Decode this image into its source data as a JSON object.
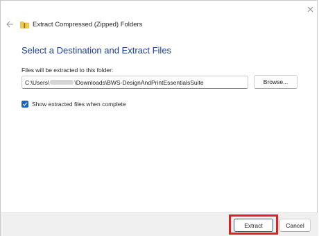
{
  "window": {
    "title": "Extract Compressed (Zipped) Folders",
    "title_icon": "zip-folder-icon",
    "close_icon": "close-icon",
    "back_icon": "back-arrow-icon"
  },
  "main": {
    "heading": "Select a Destination and Extract Files",
    "path_label": "Files will be extracted to this folder:",
    "path_prefix": "C:\\Users\\",
    "path_suffix": "\\Downloads\\BWS-DesignAndPrintEssentialsSuite",
    "browse_label": "Browse...",
    "show_files_label": "Show extracted files when complete",
    "show_files_checked": true
  },
  "footer": {
    "extract_label": "Extract",
    "cancel_label": "Cancel"
  },
  "colors": {
    "heading": "#1a3f91",
    "accent": "#1b62bf",
    "highlight": "#e02020",
    "footer_bg": "#f0f0f0"
  }
}
